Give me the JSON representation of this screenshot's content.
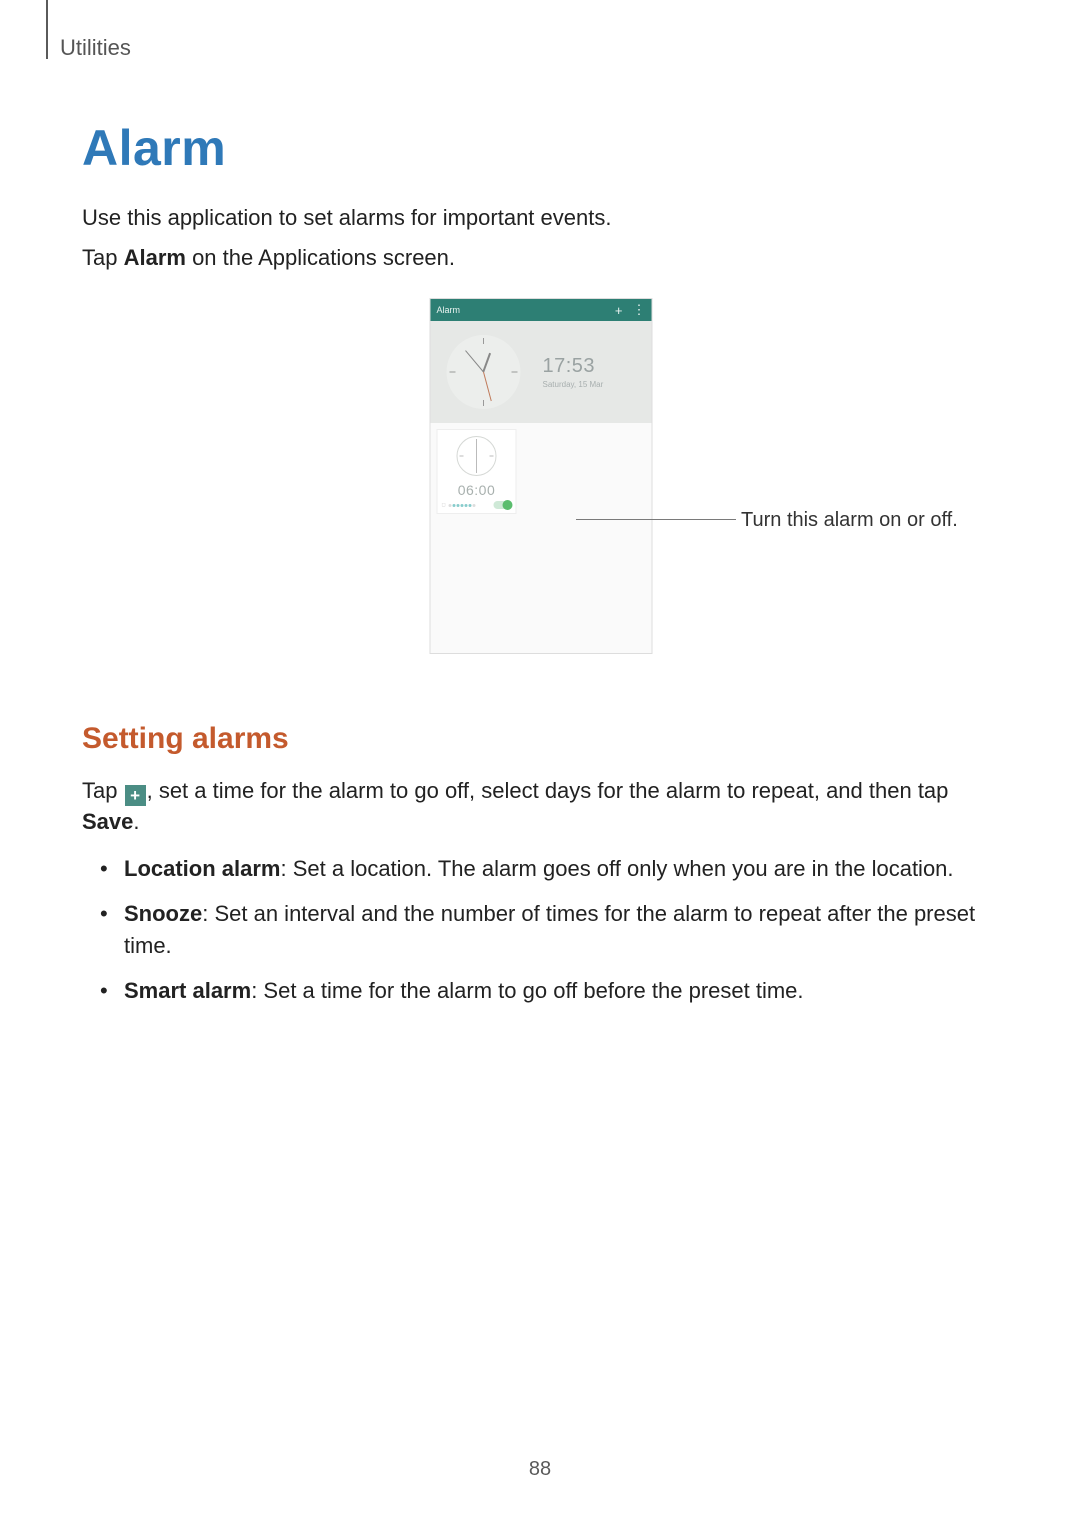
{
  "header": {
    "section": "Utilities"
  },
  "title": "Alarm",
  "intro": [
    "Use this application to set alarms for important events.",
    {
      "pre": "Tap ",
      "bold": "Alarm",
      "post": " on the Applications screen."
    }
  ],
  "screenshot": {
    "app_title": "Alarm",
    "current_time": "17:53",
    "current_date": "Saturday, 15 Mar",
    "alarms": [
      {
        "time": "06:00",
        "enabled": true
      }
    ]
  },
  "callout": "Turn this alarm on or off.",
  "subtitle": "Setting alarms",
  "setting_para": {
    "pre": "Tap ",
    "post_icon": ", set a time for the alarm to go off, select days for the alarm to repeat, and then tap ",
    "bold_end": "Save",
    "tail": "."
  },
  "bullets": [
    {
      "bold": "Location alarm",
      "text": ": Set a location. The alarm goes off only when you are in the location."
    },
    {
      "bold": "Snooze",
      "text": ": Set an interval and the number of times for the alarm to repeat after the preset time."
    },
    {
      "bold": "Smart alarm",
      "text": ": Set a time for the alarm to go off before the preset time."
    }
  ],
  "page_number": "88"
}
